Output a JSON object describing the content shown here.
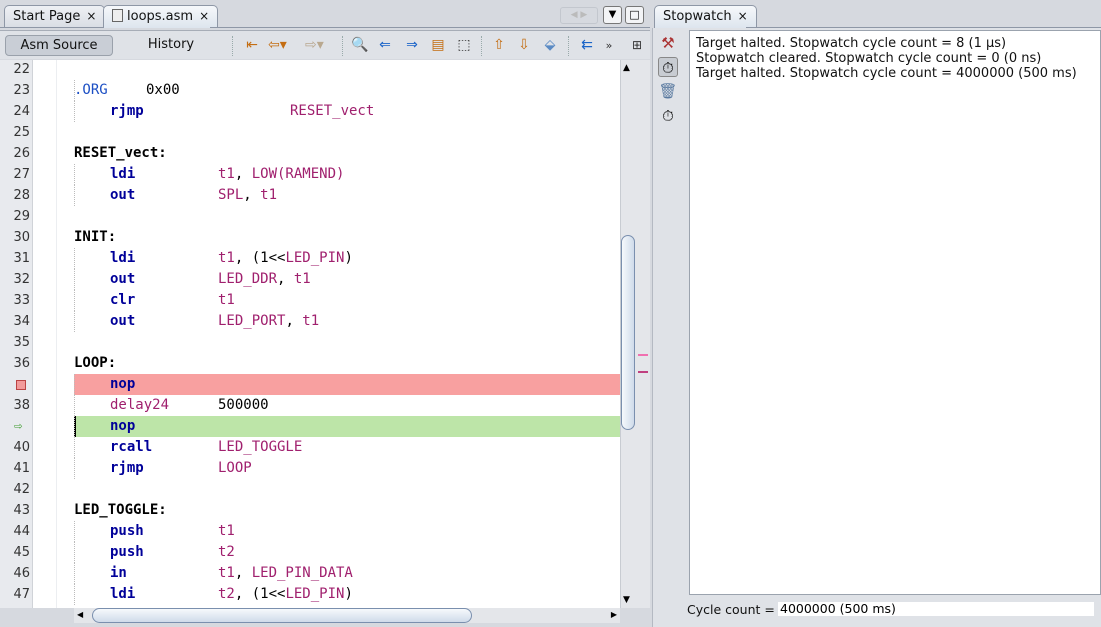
{
  "editor_tabs": [
    {
      "label": "Start Page",
      "close": "×"
    },
    {
      "label": "loops.asm",
      "close": "×"
    }
  ],
  "toolbar": {
    "asm_source": "Asm Source",
    "history": "History"
  },
  "stopwatch": {
    "tab_label": "Stopwatch",
    "close": "×",
    "messages": [
      "Target halted. Stopwatch cycle count = 8 (1 µs)",
      "Stopwatch cleared. Stopwatch cycle count = 0 (0 ns)",
      "Target halted. Stopwatch cycle count = 4000000 (500 ms)"
    ],
    "cycle_label": "Cycle count =",
    "cycle_value": "4000000 (500 ms)"
  },
  "colors": {
    "breakpoint_line": "#f8a0a0",
    "current_line": "#bde5a8",
    "keyword": "#000099",
    "operand": "#a0206e"
  },
  "code": [
    {
      "n": "22"
    },
    {
      "n": "23",
      "dir": ".ORG",
      "dirarg": "0x00"
    },
    {
      "n": "24",
      "op": "rjmp",
      "far": true,
      "args": [
        [
          "RESET_vect",
          "p"
        ]
      ]
    },
    {
      "n": "25"
    },
    {
      "n": "26",
      "label": "RESET_vect:"
    },
    {
      "n": "27",
      "op": "ldi",
      "args": [
        [
          "t1",
          "p"
        ],
        [
          ", ",
          "k"
        ],
        [
          "LOW(RAMEND)",
          "p"
        ]
      ]
    },
    {
      "n": "28",
      "op": "out",
      "args": [
        [
          "SPL",
          "p"
        ],
        [
          ", ",
          "k"
        ],
        [
          "t1",
          "p"
        ]
      ]
    },
    {
      "n": "29"
    },
    {
      "n": "30",
      "label": "INIT:"
    },
    {
      "n": "31",
      "op": "ldi",
      "args": [
        [
          "t1",
          "p"
        ],
        [
          ", (1<<",
          "k"
        ],
        [
          "LED_PIN",
          "p"
        ],
        [
          ")",
          "k"
        ]
      ]
    },
    {
      "n": "32",
      "op": "out",
      "args": [
        [
          "LED_DDR",
          "p"
        ],
        [
          ", ",
          "k"
        ],
        [
          "t1",
          "p"
        ]
      ]
    },
    {
      "n": "33",
      "op": "clr",
      "args": [
        [
          "t1",
          "p"
        ]
      ]
    },
    {
      "n": "34",
      "op": "out",
      "args": [
        [
          "LED_PORT",
          "p"
        ],
        [
          ", ",
          "k"
        ],
        [
          "t1",
          "p"
        ]
      ]
    },
    {
      "n": "35"
    },
    {
      "n": "36",
      "label": "LOOP:"
    },
    {
      "n": "37",
      "marker": "breakpoint",
      "op": "nop"
    },
    {
      "n": "38",
      "op": "delay24",
      "macro": true,
      "args": [
        [
          "500000",
          "k"
        ]
      ]
    },
    {
      "n": "39",
      "marker": "current",
      "op": "nop"
    },
    {
      "n": "40",
      "op": "rcall",
      "args": [
        [
          "LED_TOGGLE",
          "p"
        ]
      ]
    },
    {
      "n": "41",
      "op": "rjmp",
      "args": [
        [
          "LOOP",
          "p"
        ]
      ]
    },
    {
      "n": "42"
    },
    {
      "n": "43",
      "label": "LED_TOGGLE:"
    },
    {
      "n": "44",
      "op": "push",
      "args": [
        [
          "t1",
          "p"
        ]
      ]
    },
    {
      "n": "45",
      "op": "push",
      "args": [
        [
          "t2",
          "p"
        ]
      ]
    },
    {
      "n": "46",
      "op": "in",
      "args": [
        [
          "t1",
          "p"
        ],
        [
          ", ",
          "k"
        ],
        [
          "LED_PIN_DATA",
          "p"
        ]
      ]
    },
    {
      "n": "47",
      "op": "ldi",
      "args": [
        [
          "t2",
          "p"
        ],
        [
          ", (1<<",
          "k"
        ],
        [
          "LED_PIN",
          "p"
        ],
        [
          ")",
          "k"
        ]
      ]
    }
  ]
}
